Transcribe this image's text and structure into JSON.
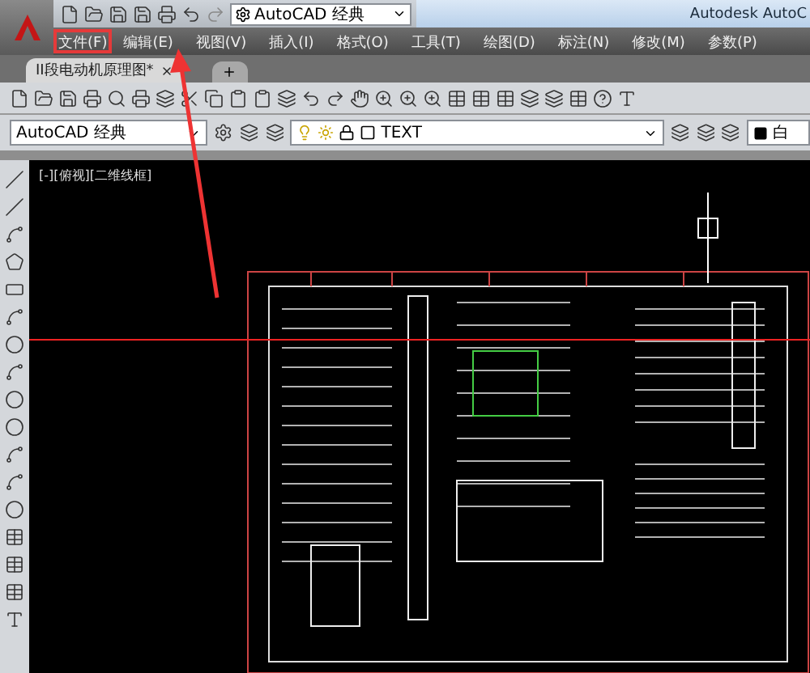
{
  "title_bar": {
    "workspace": "AutoCAD 经典",
    "title": "Autodesk AutoC"
  },
  "menu": [
    {
      "label": "文件(F)",
      "selected": true
    },
    {
      "label": "编辑(E)",
      "selected": false
    },
    {
      "label": "视图(V)",
      "selected": false
    },
    {
      "label": "插入(I)",
      "selected": false
    },
    {
      "label": "格式(O)",
      "selected": false
    },
    {
      "label": "工具(T)",
      "selected": false
    },
    {
      "label": "绘图(D)",
      "selected": false
    },
    {
      "label": "标注(N)",
      "selected": false
    },
    {
      "label": "修改(M)",
      "selected": false
    },
    {
      "label": "参数(P)",
      "selected": false
    }
  ],
  "tabs": [
    {
      "label": "II段电动机原理图*",
      "selected": true
    }
  ],
  "workspace_combo": "AutoCAD 经典",
  "layer_combo": "TEXT",
  "color_combo": "白",
  "viewport_label": "[-][俯视][二维线框]"
}
